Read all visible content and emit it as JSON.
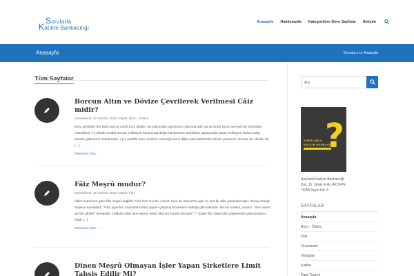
{
  "header": {
    "logo_line1": "Sorularla",
    "logo_line2": "Katılım Bankacılığı",
    "nav": [
      "Anasayfa",
      "Hakkımızda",
      "Kategorilere Göre Sayfalar",
      "İletişim"
    ],
    "active_index": 0
  },
  "titlebar": {
    "title": "Anasayfa",
    "breadcrumb_label": "Buradasınız:",
    "breadcrumb_current": "Anasayfa"
  },
  "main": {
    "title": "Tüm Sayfalar",
    "read_more": "Devamını Oku →",
    "posts": [
      {
        "title": "Borcun Altın ve Dövize Çevrilerek Verilmesi Câiz midir?",
        "meta_updated": "Güncelleme: 30 Haziran 2015",
        "meta_sep": "/",
        "meta_page": "Sayfa:",
        "meta_category": "Borç – Ödünç",
        "excerpt": "Borç verilebilir her türlü mal ve varlık borç olabilir. Bu bakımdan para borcu yanında altın ya da döviz borcu vermek de meşrûdur. Alacaklının TL olarak verdiği borcun enflasyon karşısında değer kaybetmesi sebebiyle uğrayacağı zararı enflasyon farkını talep ederek gidermesi mümkündür. Aynı şekilde borç verirken vereceği borcu diğer para türlerinden birine çevirerek vermesi de câizdir. Bu […]"
      },
      {
        "title": "Fâiz Meşrû mudur?",
        "meta_updated": "Güncelleme: 30 Haziran 2015",
        "meta_sep": "/",
        "meta_page": "Sayfa:",
        "meta_category": "Fâiz",
        "excerpt": "İslâm hukukuna göre fâiz meşrû değildir. Fâiz hem Kur'ân-ı Kerim hem de Sünnet'te açık ve sert bir dille yasaklanmıştır. Birkaç örneği söylece sunabiliriz: \"Fâiz yiyenler, (mezarlarından) şeytan çarpmış kimselerin kalktığı gibi kalkarlar. Bunun nedeni, onların, \"alım satım da fâiz gibidir\" demesidir. Halbuki Allah alım-satımı helal, fâizi ise haram kılmıştır\".7 \"Şayet fâiz hakkında söylenenleri yapmazsanız, Allah […]"
      },
      {
        "title": "Dinen Meşrû Olmayan İşler Yapan Şirketlere Limit",
        "title_line2": "Tahsis Edilir Mi?"
      }
    ]
  },
  "sidebar": {
    "search_placeholder": "Ara",
    "book_title_line1": "SORULARLA",
    "book_title_line2": "KATILIM BANKACILIĞI",
    "book_symbol": "?",
    "book_caption": [
      "Sorularla Katılım Bankacılığı",
      "Doç. Dr. İshak Emin AKTEPE",
      "TKBB Yayın No: 5"
    ],
    "widget_title": "SAYFALAR",
    "pages": [
      "Anasayfa",
      "Borç – Ödünç",
      "Fâiz",
      "Finansman",
      "Hesaplar",
      "Kartlar",
      "Para Ticareti"
    ]
  },
  "colors": {
    "accent": "#1e73be",
    "text": "#333333",
    "book_yellow": "#f2d21a"
  }
}
